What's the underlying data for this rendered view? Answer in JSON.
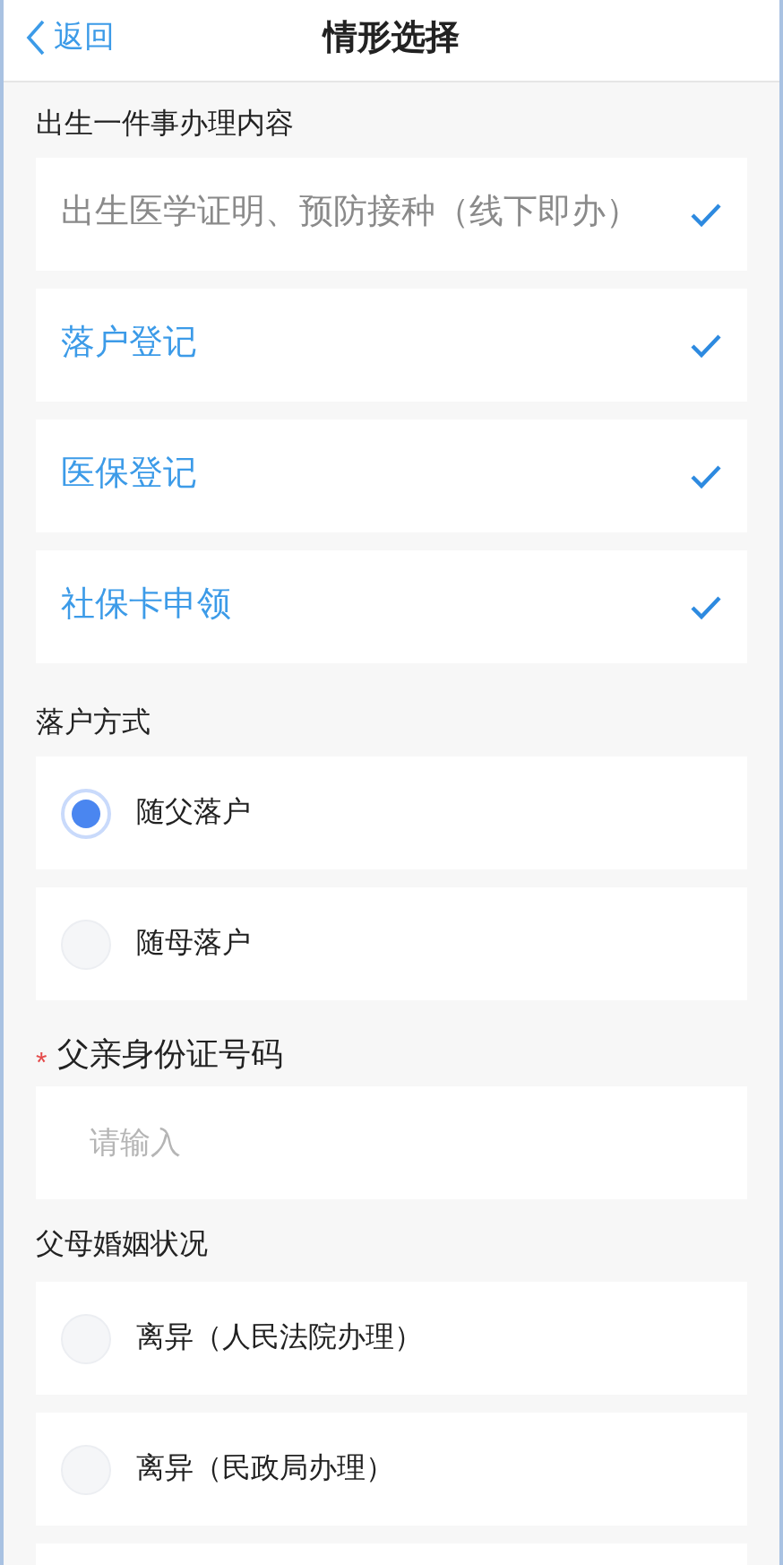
{
  "nav": {
    "back": "返回",
    "title": "情形选择"
  },
  "services": {
    "label": "出生一件事办理内容",
    "items": [
      {
        "label": "出生医学证明、预防接种（线下即办）",
        "checked": true,
        "disabled": true
      },
      {
        "label": "落户登记",
        "checked": true,
        "disabled": false
      },
      {
        "label": "医保登记",
        "checked": true,
        "disabled": false
      },
      {
        "label": "社保卡申领",
        "checked": true,
        "disabled": false
      }
    ]
  },
  "registration": {
    "label": "落户方式",
    "options": [
      {
        "label": "随父落户",
        "selected": true
      },
      {
        "label": "随母落户",
        "selected": false
      }
    ]
  },
  "father_id": {
    "label": "父亲身份证号码",
    "required_mark": "*",
    "placeholder": "请输入"
  },
  "marital_status": {
    "label": "父母婚姻状况",
    "options": [
      {
        "label": "离异（人民法院办理）",
        "selected": false
      },
      {
        "label": "离异（民政局办理）",
        "selected": false
      }
    ]
  }
}
